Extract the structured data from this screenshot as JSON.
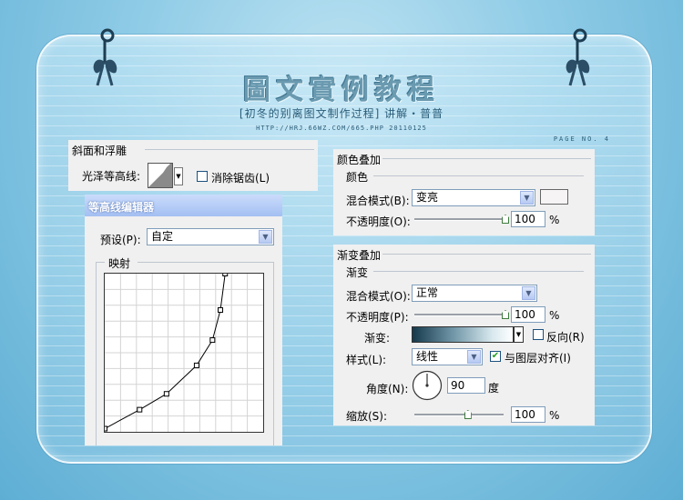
{
  "header": {
    "title": "圖文實例教程",
    "subtitle": "[初冬的别离图文制作过程]   讲解・普普",
    "url": "HTTP://HRJ.66WZ.COM/665.PHP   20110125",
    "page_no": "PAGE NO. 4"
  },
  "bevel": {
    "title": "斜面和浮雕",
    "gloss_label": "光泽等高线:",
    "antialias_label": "消除锯齿(L)"
  },
  "contour_editor": {
    "title": "等高线编辑器",
    "preset_label": "预设(P):",
    "preset_value": "自定",
    "mapping_label": "映射",
    "curve_points": [
      [
        0,
        0.02
      ],
      [
        0.22,
        0.14
      ],
      [
        0.39,
        0.24
      ],
      [
        0.58,
        0.42
      ],
      [
        0.68,
        0.58
      ],
      [
        0.73,
        0.77
      ],
      [
        0.76,
        1.0
      ]
    ]
  },
  "color_overlay": {
    "section_title": "颜色叠加",
    "group_title": "颜色",
    "blend_label": "混合模式(B):",
    "blend_value": "变亮",
    "opacity_label": "不透明度(O):",
    "opacity_value": "100",
    "opacity_level": 1.0,
    "percent": "%",
    "swatch_color": "#f6f4f4"
  },
  "gradient_overlay": {
    "section_title": "渐变叠加",
    "group_title": "渐变",
    "blend_label": "混合模式(O):",
    "blend_value": "正常",
    "opacity_label": "不透明度(P):",
    "opacity_value": "100",
    "opacity_level": 1.0,
    "gradient_label": "渐变:",
    "reverse_label": "反向(R)",
    "style_label": "样式(L):",
    "style_value": "线性",
    "align_label": "与图层对齐(I)",
    "angle_label": "角度(N):",
    "angle_value": "90",
    "angle_unit": "度",
    "scale_label": "缩放(S):",
    "scale_value": "100",
    "scale_level": 0.6,
    "percent": "%"
  },
  "colors": {
    "group_title": "#0b3b8c",
    "editor_title_bar": "#aec7f6"
  }
}
